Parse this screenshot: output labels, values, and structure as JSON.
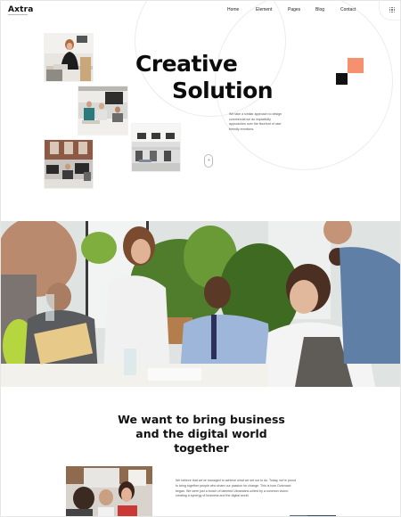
{
  "brand": {
    "name": "Axtra"
  },
  "nav": {
    "items": [
      "Home",
      "Element",
      "Pages",
      "Blog",
      "Contact"
    ]
  },
  "hero": {
    "title_line1": "Creative",
    "title_line2": "Solution",
    "description": "We take a similar approach to design commercial we do impactfully approaches over the flourfont of user friendly emotions.",
    "scroll_symbol": "+"
  },
  "section2": {
    "heading": "We want to bring business and the digital world together",
    "body": "We believe that we've managed to achieve what we set out to do. Today, we're proud to bring together people who share our passion for change. This is how Outcrowd began. We were just a bunch of talented Ukrainians united by a common vision: creating a synergy of business and the digital world."
  },
  "colors": {
    "accent": "#f6916f",
    "dark": "#121212"
  }
}
